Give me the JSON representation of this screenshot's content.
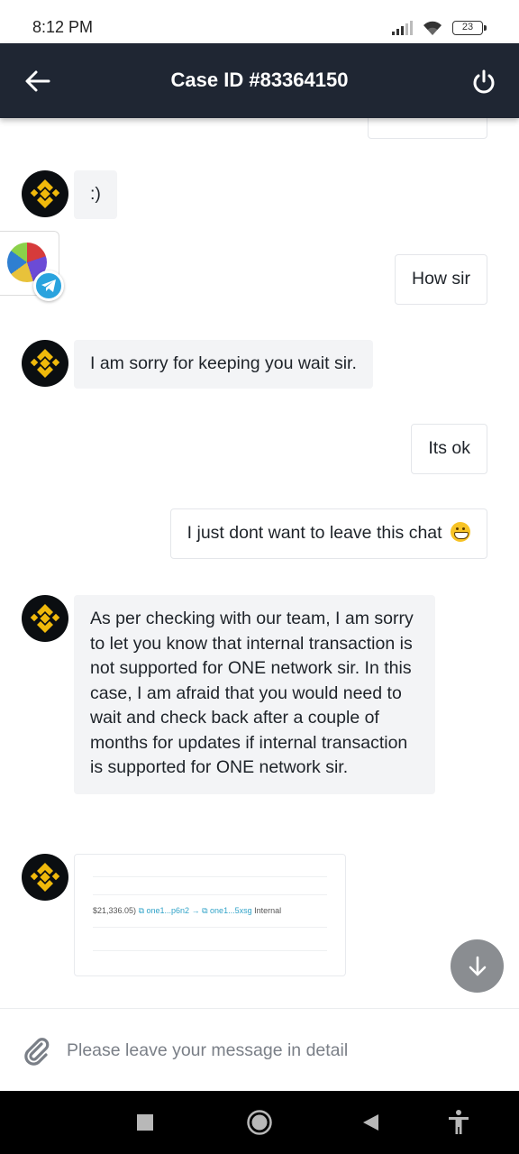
{
  "status_bar": {
    "time": "8:12 PM",
    "battery": "23"
  },
  "header": {
    "title": "Case ID #83364150"
  },
  "messages": {
    "agent_smile": ":)",
    "user_how": "How sir",
    "agent_sorry": "I am sorry for keeping you wait sir.",
    "user_ok": "Its ok",
    "user_dont_leave": "I just dont want to leave this chat",
    "agent_long": "As per checking with our team, I am sorry to let you know that internal transaction is not supported for ONE network sir. In this case, I am afraid that you would need to wait and check back after a couple of months for updates if internal transaction is supported for ONE network sir."
  },
  "image_card": {
    "amount": "$21,336.05)",
    "from": "one1...p6n2",
    "to": "one1...5xsg",
    "type": "Internal"
  },
  "input": {
    "placeholder": "Please leave your message in detail"
  },
  "icons": {
    "back": "arrow-left-icon",
    "power": "power-icon",
    "avatar": "binance-logo",
    "telegram": "telegram-icon",
    "scroll": "arrow-down-icon",
    "attach": "paperclip-icon",
    "nav_recents": "square-icon",
    "nav_home": "circle-icon",
    "nav_back": "triangle-icon",
    "nav_accessibility": "accessibility-icon"
  },
  "colors": {
    "header_bg": "#1f2633",
    "brand_yellow": "#f0b90b",
    "bubble_in": "#f3f4f6",
    "telegram_blue": "#2aa3de"
  }
}
